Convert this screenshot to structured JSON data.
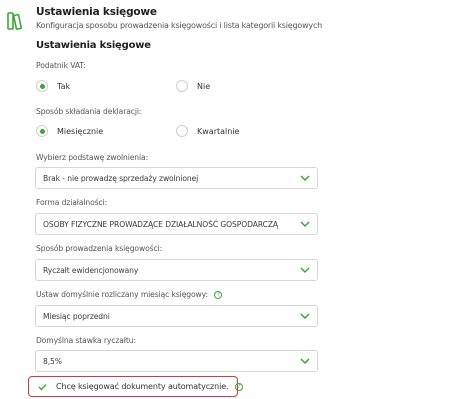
{
  "header": {
    "title": "Ustawienia księgowe",
    "subtitle": "Konfiguracja sposobu prowadzenia księgowości i lista kategorii księgowych",
    "icon": "books-icon"
  },
  "section": {
    "title": "Ustawienia księgowe"
  },
  "vat": {
    "label": "Podatnik VAT:",
    "options": [
      {
        "label": "Tak",
        "selected": true
      },
      {
        "label": "Nie",
        "selected": false
      }
    ]
  },
  "declaration": {
    "label": "Sposób składania deklaracji:",
    "options": [
      {
        "label": "Miesięcznie",
        "selected": true
      },
      {
        "label": "Kwartalnie",
        "selected": false
      }
    ]
  },
  "exemption": {
    "label": "Wybierz podstawę zwolnienia:",
    "value": "Brak - nie prowadzę sprzedaży zwolnionej"
  },
  "legal_form": {
    "label": "Forma działalności:",
    "value": "OSOBY FIZYCZNE PROWADZĄCE DZIAŁALNOŚĆ GOSPODARCZĄ"
  },
  "accounting_method": {
    "label": "Sposób prowadzenia księgowości:",
    "value": "Ryczałt ewidencjonowany"
  },
  "default_month": {
    "label": "Ustaw domyślnie rozliczany miesiąc księgowy:",
    "value": "Miesiąc poprzedni",
    "info_icon": "?"
  },
  "flat_rate": {
    "label": "Domyślna stawka ryczałtu:",
    "value": "8,5%"
  },
  "auto_booking": {
    "label": "Chcę księgować dokumenty automatycznie.",
    "checked": true,
    "info_icon": "?"
  },
  "colors": {
    "accent": "#39a935",
    "highlight": "#d9363e",
    "border": "#d6d6d6"
  }
}
